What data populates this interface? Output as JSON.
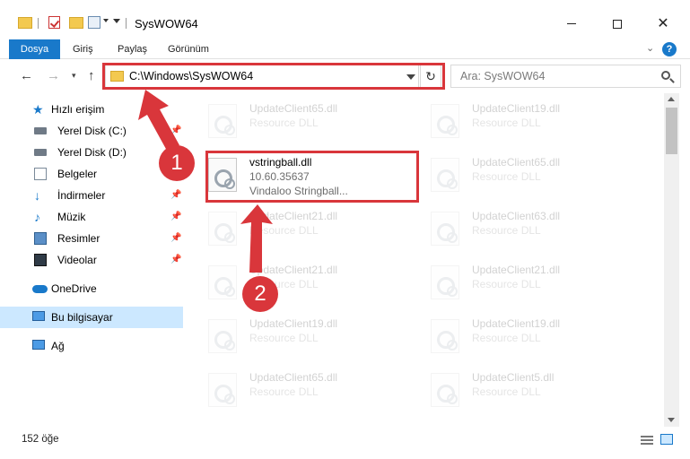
{
  "window": {
    "title": "SysWOW64",
    "close_glyph": "✕"
  },
  "ribbon": {
    "tabs": [
      {
        "label": "Dosya",
        "active": true
      },
      {
        "label": "Giriş"
      },
      {
        "label": "Paylaş"
      },
      {
        "label": "Görünüm"
      }
    ],
    "help_label": "?",
    "expand_glyph": "⌄"
  },
  "nav": {
    "back_glyph": "←",
    "forward_glyph": "→",
    "recent_glyph": "▾",
    "up_glyph": "↑",
    "address": "C:\\Windows\\SysWOW64",
    "refresh_glyph": "↻",
    "search_placeholder": "Ara: SysWOW64"
  },
  "sidebar": {
    "items": [
      {
        "label": "Hızlı erişim",
        "icon": "star-icon"
      },
      {
        "label": "Yerel Disk (C:)",
        "icon": "disk-icon",
        "pinned": true
      },
      {
        "label": "Yerel Disk (D:)",
        "icon": "disk-icon"
      },
      {
        "label": "Belgeler",
        "icon": "document-icon",
        "pinned": true
      },
      {
        "label": "İndirmeler",
        "icon": "download-icon",
        "pinned": true
      },
      {
        "label": "Müzik",
        "icon": "music-icon",
        "pinned": true
      },
      {
        "label": "Resimler",
        "icon": "pictures-icon",
        "pinned": true
      },
      {
        "label": "Videolar",
        "icon": "videos-icon",
        "pinned": true
      },
      {
        "label": "OneDrive",
        "icon": "onedrive-icon"
      },
      {
        "label": "Bu bilgisayar",
        "icon": "pc-icon",
        "selected": true
      },
      {
        "label": "Ağ",
        "icon": "network-icon"
      }
    ],
    "pin_glyph": "📌"
  },
  "files": {
    "highlighted": {
      "name": "vstringball.dll",
      "version": "10.60.35637",
      "description": "Vindaloo Stringball..."
    },
    "background": [
      {
        "name": "UpdateClient65.dll",
        "type": "Resource DLL"
      },
      {
        "name": "UpdateClient19.dll",
        "type": "Resource DLL"
      },
      {
        "name": "UpdateClient65.dll",
        "type": "Resource DLL"
      },
      {
        "name": "UpdateClient21.dll",
        "type": "Resource DLL"
      },
      {
        "name": "UpdateClient63.dll",
        "type": "Resource DLL"
      },
      {
        "name": "UpdateClient21.dll",
        "type": "Resource DLL"
      },
      {
        "name": "UpdateClient21.dll",
        "type": "Resource DLL"
      },
      {
        "name": "UpdateClient19.dll",
        "type": "Resource DLL"
      },
      {
        "name": "UpdateClient19.dll",
        "type": "Resource DLL"
      },
      {
        "name": "UpdateClient65.dll",
        "type": "Resource DLL"
      },
      {
        "name": "UpdateClient5.dll",
        "type": "Resource DLL"
      }
    ]
  },
  "status": {
    "item_count": "152 öğe"
  },
  "annotations": {
    "step1": "1",
    "step2": "2",
    "color": "#d9363b"
  }
}
